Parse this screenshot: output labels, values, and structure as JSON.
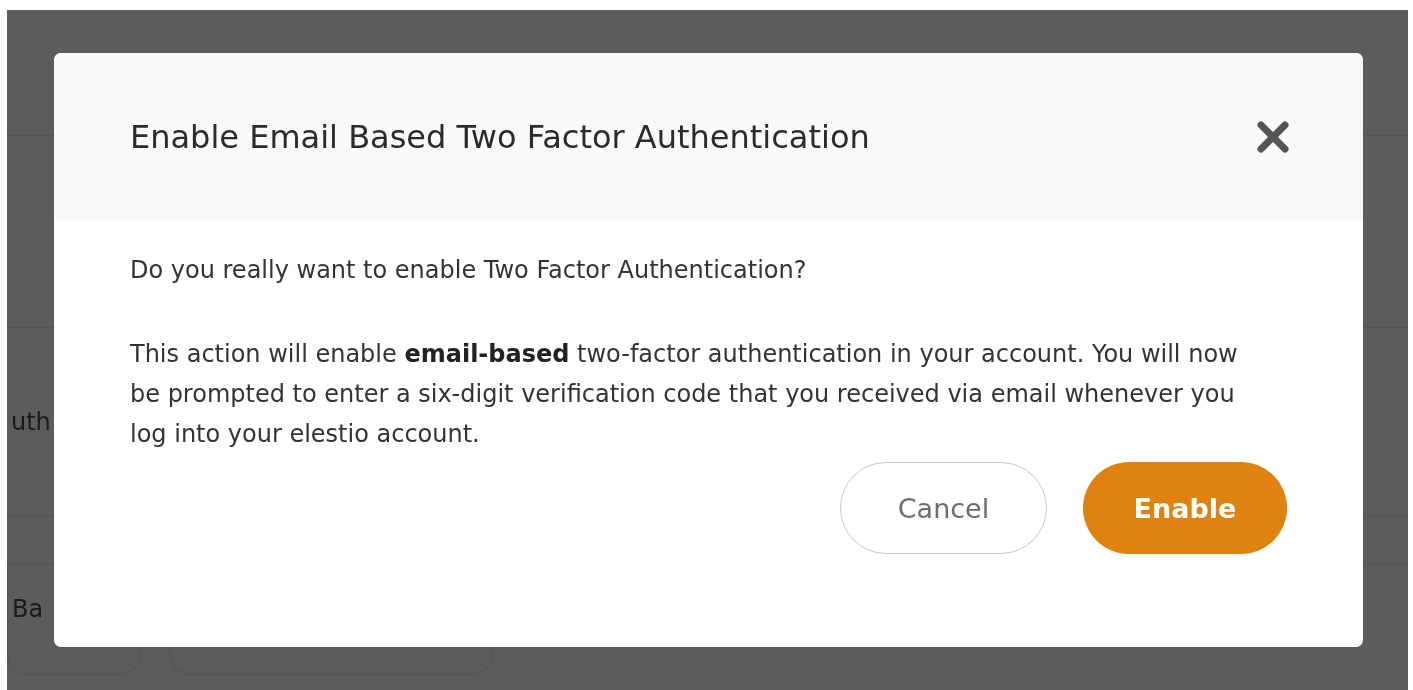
{
  "background": {
    "section_label": "uth",
    "button_label": "Ba"
  },
  "dialog": {
    "title": "Enable Email Based Two Factor Authentication",
    "question": "Do you really want to enable Two Factor Authentication?",
    "message": "This action will enable **email-based** two-factor authentication in your account. You will now be prompted to enter a six-digit verification code that you received via email whenever you log into your elestio account.",
    "buttons": [
      {
        "label": "Cancel",
        "kind": "secondary"
      },
      {
        "label": "Enable",
        "kind": "primary"
      }
    ]
  }
}
